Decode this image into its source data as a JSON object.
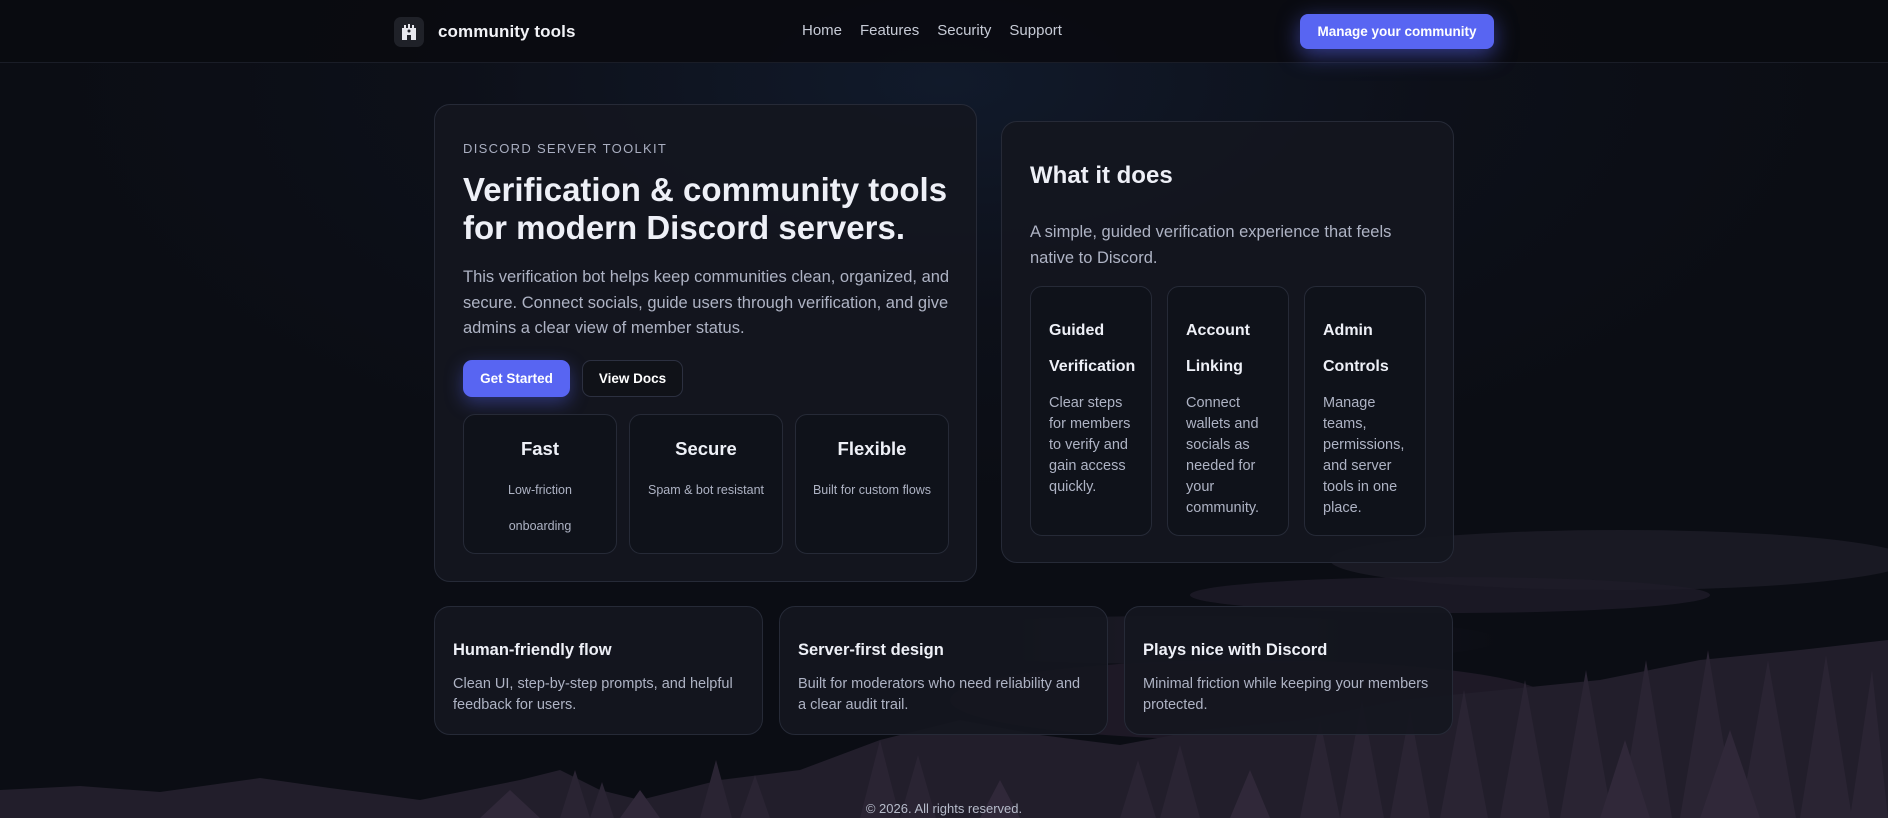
{
  "header": {
    "brand": "community tools",
    "nav": [
      "Home",
      "Features",
      "Security",
      "Support"
    ],
    "cta": "Manage your community"
  },
  "hero": {
    "eyebrow": "DISCORD SERVER TOOLKIT",
    "title": "Verification & community tools for modern Discord servers.",
    "description": "This verification bot helps keep communities clean, organized, and secure. Connect socials, guide users through verification, and give admins a clear view of member status.",
    "primary_button": "Get Started",
    "secondary_button": "View Docs",
    "stats": [
      {
        "title": "Fast",
        "desc": "Low-friction onboarding"
      },
      {
        "title": "Secure",
        "desc": "Spam & bot resistant"
      },
      {
        "title": "Flexible",
        "desc": "Built for custom flows"
      }
    ]
  },
  "what": {
    "title": "What it does",
    "description": "A simple, guided verification experience that feels native to Discord.",
    "features": [
      {
        "title": "Guided Verification",
        "desc": "Clear steps for members to verify and gain access quickly."
      },
      {
        "title": "Account Linking",
        "desc": "Connect wallets and socials as needed for your community."
      },
      {
        "title": "Admin Controls",
        "desc": "Manage teams, permissions, and server tools in one place."
      }
    ]
  },
  "highlights": [
    {
      "title": "Human-friendly flow",
      "desc": "Clean UI, step-by-step prompts, and helpful feedback for users."
    },
    {
      "title": "Server-first design",
      "desc": "Built for moderators who need reliability and a clear audit trail."
    },
    {
      "title": "Plays nice with Discord",
      "desc": "Minimal friction while keeping your members protected."
    }
  ],
  "footer": "© 2026. All rights reserved.",
  "colors": {
    "accent": "#5865f2",
    "background": "#0c0e15",
    "card": "#14161f"
  },
  "icons": {
    "logo": "castle-icon"
  }
}
